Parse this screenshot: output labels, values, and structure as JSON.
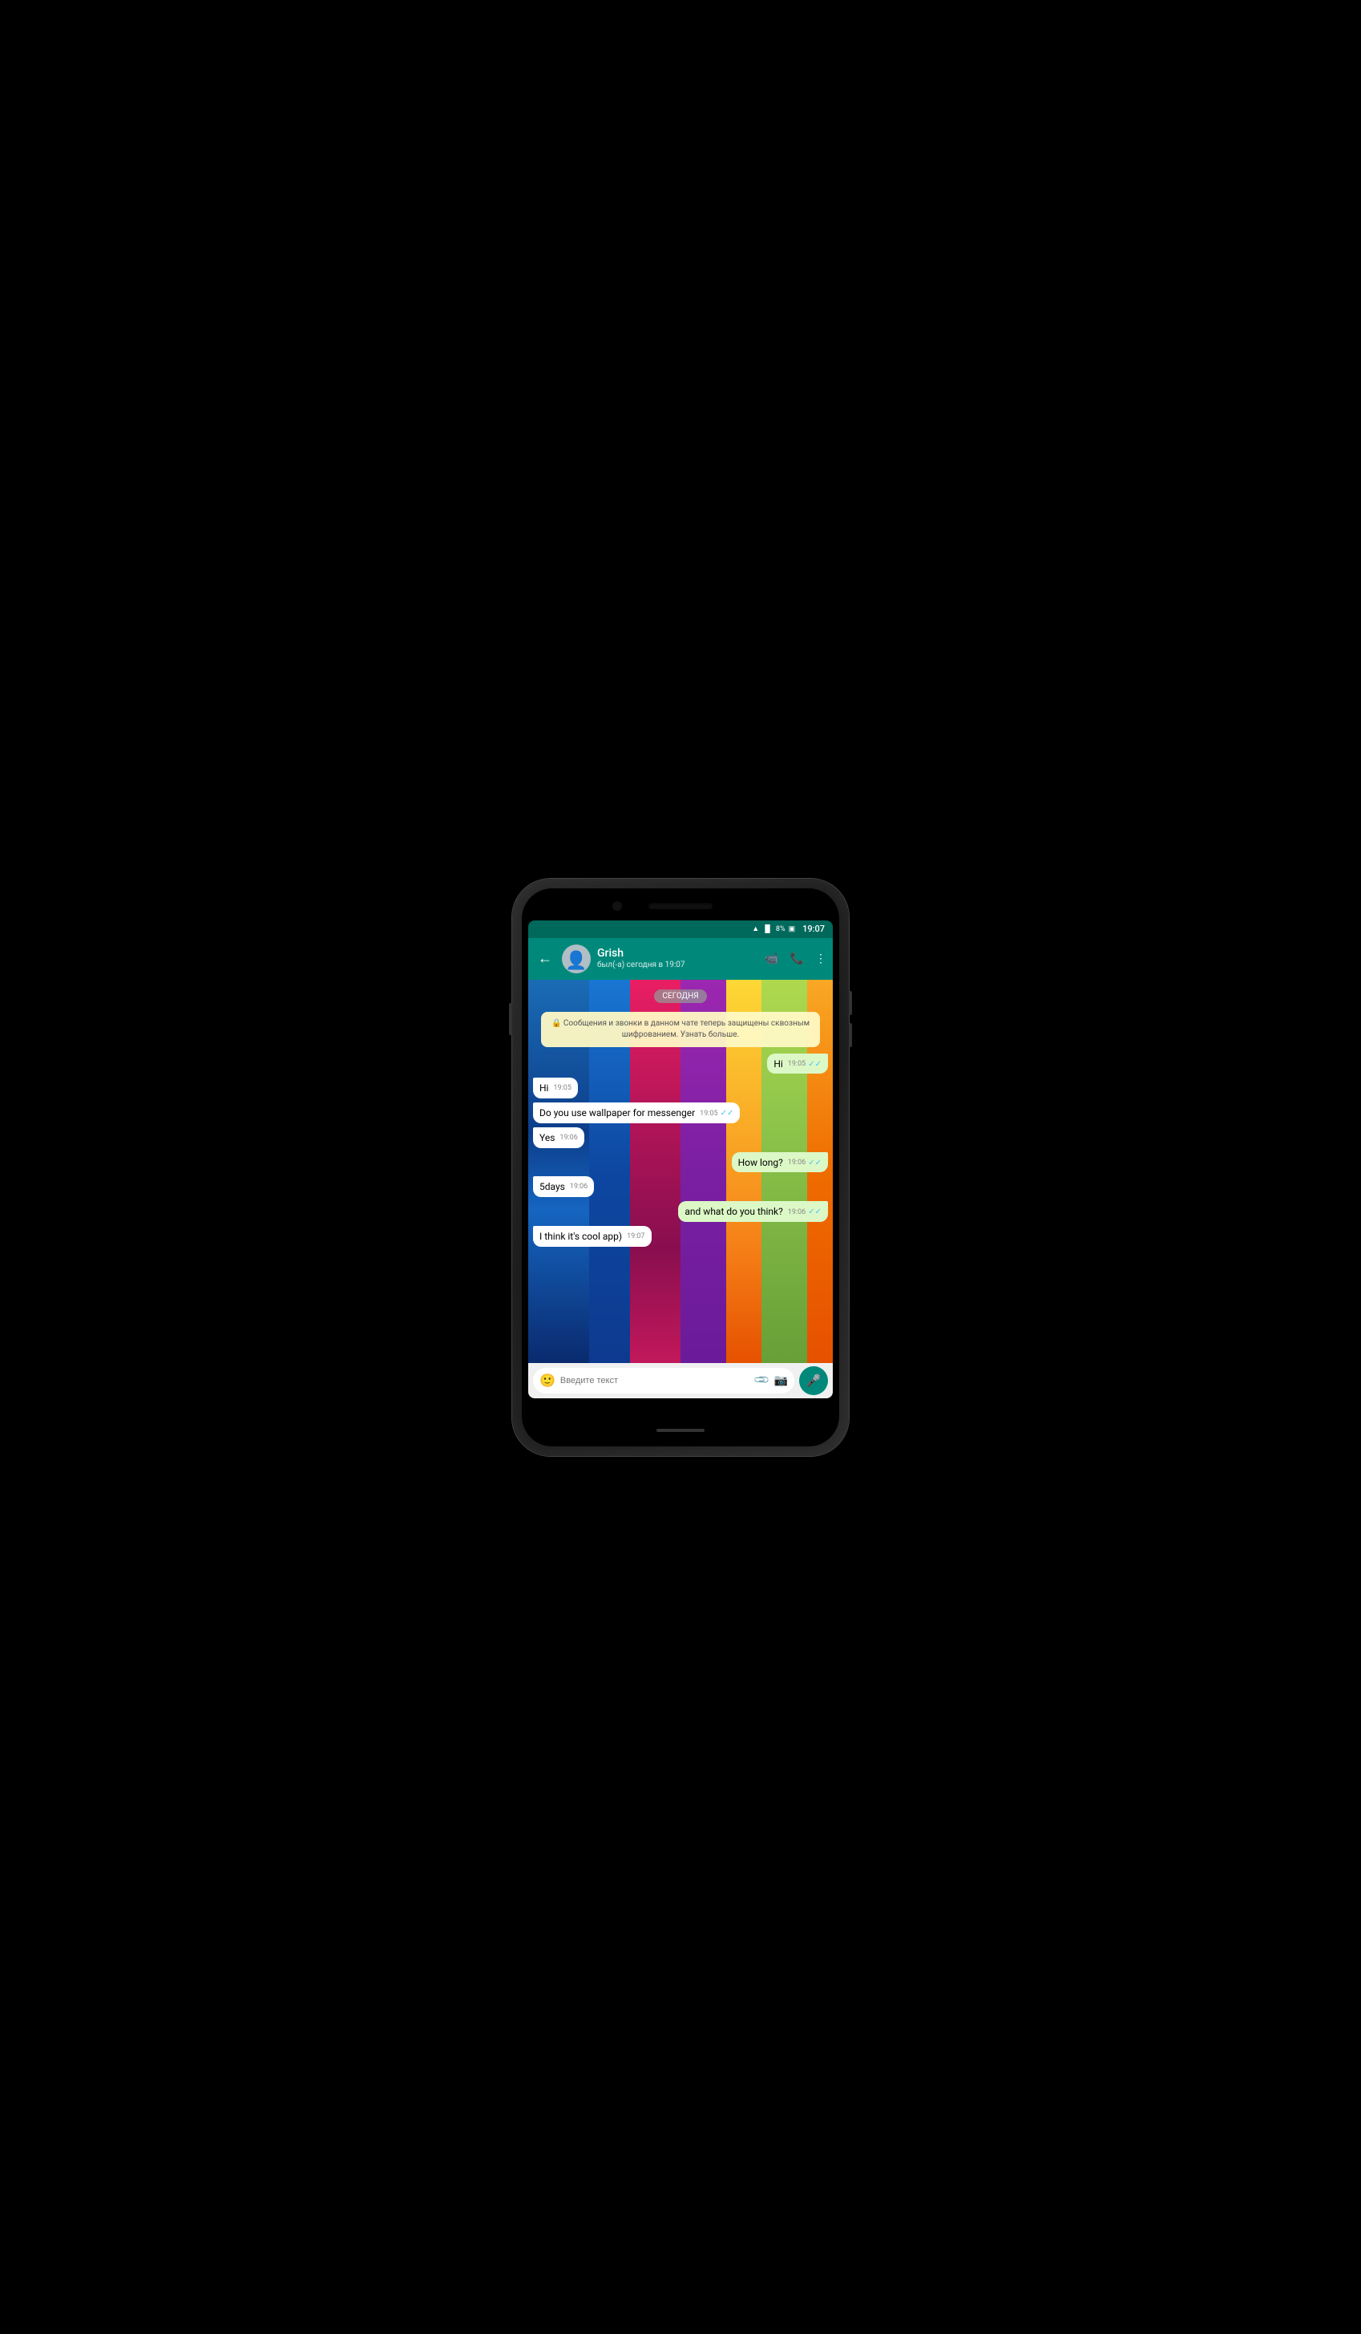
{
  "status_bar": {
    "wifi_icon": "📶",
    "signal_icon": "📶",
    "battery_percent": "8%",
    "battery_icon": "🔋",
    "time": "19:07"
  },
  "header": {
    "back_label": "←",
    "contact_name": "Grish",
    "contact_status": "был(-а) сегодня в 19:07",
    "video_icon": "📹",
    "call_icon": "📞",
    "more_icon": "⋮"
  },
  "chat": {
    "date_badge": "СЕГОДНЯ",
    "encryption_notice": "🔒 Сообщения и звонки в данном чате теперь защищены сквозным шифрованием. Узнать больше.",
    "messages": [
      {
        "id": 1,
        "type": "outgoing",
        "text": "Hi",
        "time": "19:05",
        "ticks": "✓✓"
      },
      {
        "id": 2,
        "type": "incoming",
        "text": "Hi",
        "time": "19:05"
      },
      {
        "id": 3,
        "type": "incoming",
        "text": "Do you use wallpaper for messenger",
        "time": "19:05",
        "ticks": "✓✓"
      },
      {
        "id": 4,
        "type": "incoming",
        "text": "Yes",
        "time": "19:06"
      },
      {
        "id": 5,
        "type": "outgoing",
        "text": "How long?",
        "time": "19:06",
        "ticks": "✓✓"
      },
      {
        "id": 6,
        "type": "incoming",
        "text": "5days",
        "time": "19:06"
      },
      {
        "id": 7,
        "type": "outgoing",
        "text": "and what do you think?",
        "time": "19:06",
        "ticks": "✓✓"
      },
      {
        "id": 8,
        "type": "incoming",
        "text": "I think it's cool app)",
        "time": "19:07"
      }
    ]
  },
  "input_bar": {
    "placeholder": "Введите текст",
    "emoji_icon": "😊",
    "attach_icon": "📎",
    "camera_icon": "📷",
    "mic_icon": "🎤"
  },
  "wallpaper": {
    "stripes": [
      "#1565c0",
      "#0d47a1",
      "#e91e63",
      "#ad1457",
      "#9c27b0",
      "#fdd835",
      "#c0ca33",
      "#ef6c00"
    ]
  }
}
